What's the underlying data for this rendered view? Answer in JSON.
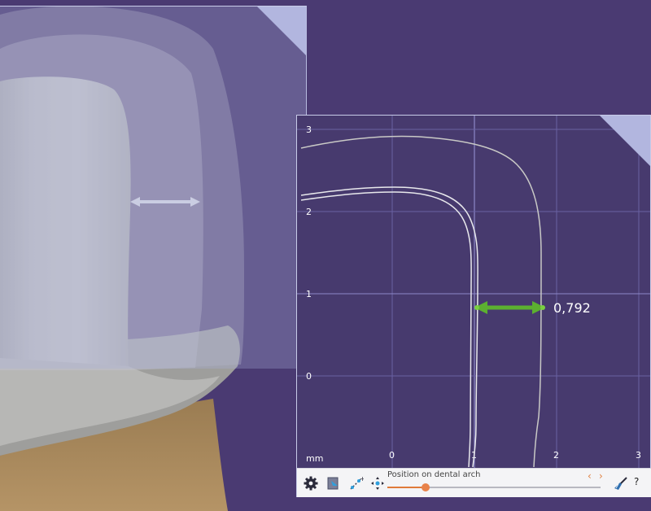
{
  "section_view": {
    "unit_label": "mm",
    "x_ticks": [
      "0",
      "1",
      "2",
      "3"
    ],
    "y_ticks": [
      "3",
      "2",
      "1",
      "0"
    ],
    "measurement": {
      "value": "0,792"
    }
  },
  "toolbar": {
    "settings_icon": "gear-icon",
    "view_icon": "view-icon",
    "points_icon": "add-points-icon",
    "arrange_icon": "move-points-icon",
    "arch_label": "Position on dental arch",
    "arch_position": 0.18,
    "prev_label": "‹",
    "next_label": "›",
    "clean_icon": "broom-icon",
    "help_label": "?"
  },
  "colors": {
    "background": "#4a3a72",
    "accent": "#e07a3a",
    "measure": "#5cb030"
  }
}
